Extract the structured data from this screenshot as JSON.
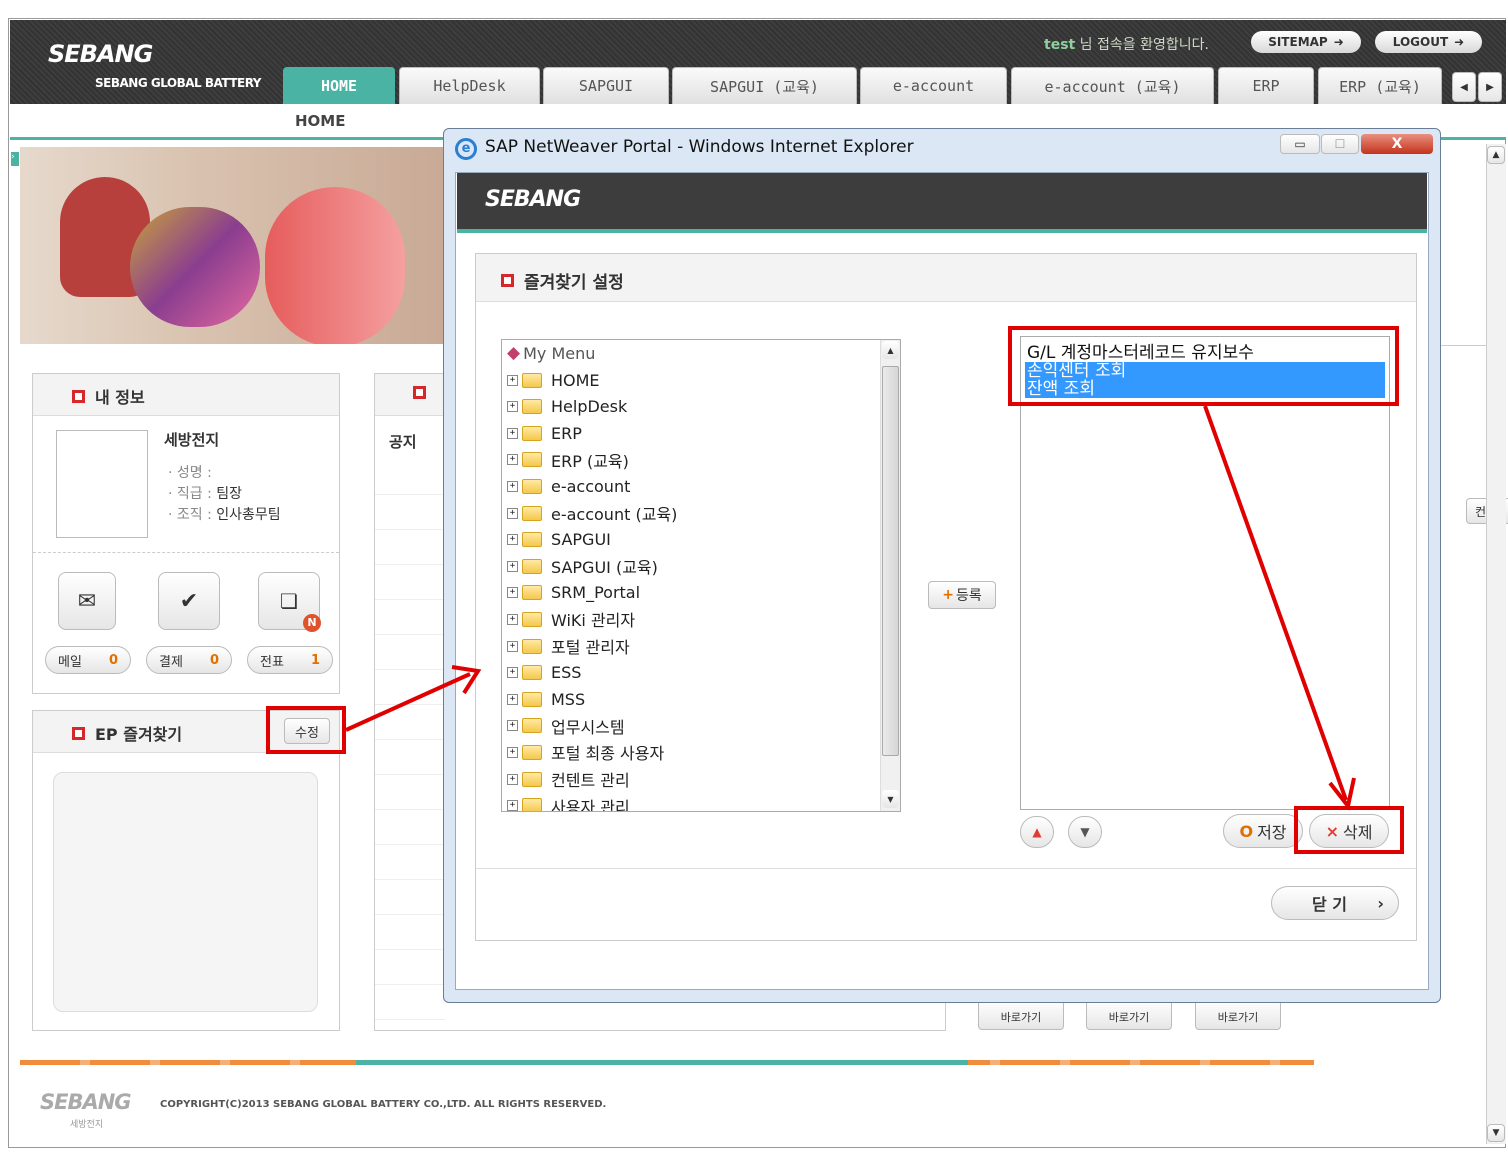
{
  "header": {
    "logo": "SEBANG",
    "logo_sub": "SEBANG GLOBAL BATTERY",
    "welcome_user": "test",
    "welcome_text": "님 접속을 환영합니다.",
    "sitemap": "SITEMAP",
    "logout": "LOGOUT",
    "tabs": [
      "HOME",
      "HelpDesk",
      "SAPGUI",
      "SAPGUI (교육)",
      "e-account",
      "e-account (교육)",
      "ERP",
      "ERP (교육)"
    ],
    "subnav": "HOME"
  },
  "myinfo": {
    "title": "내 정보",
    "company": "세방전지",
    "name_label": "· 성명 :",
    "rank_label": "· 직급 :",
    "rank_value": "팀장",
    "org_label": "· 조직 :",
    "org_value": "인사총무팀",
    "counters": [
      {
        "label": "메일",
        "value": "0"
      },
      {
        "label": "결제",
        "value": "0"
      },
      {
        "label": "전표",
        "value": "1"
      }
    ],
    "badge": "N"
  },
  "favorites": {
    "title": "EP 즐겨찾기",
    "edit_button": "수정"
  },
  "notice": {
    "label": "공지"
  },
  "shortcuts": [
    "바로가기",
    "바로가기",
    "바로가기"
  ],
  "side_tab": "컨텐",
  "footer": {
    "logo": "SEBANG",
    "logo_sub": "세방전지",
    "copyright": "COPYRIGHT(C)2013 SEBANG GLOBAL BATTERY CO.,LTD. ALL RIGHTS RESERVED."
  },
  "popup": {
    "window_title": "SAP NetWeaver Portal - Windows Internet Explorer",
    "logo": "SEBANG",
    "section_title": "즐겨찾기 설정",
    "tree_root": "My Menu",
    "tree_items": [
      "HOME",
      "HelpDesk",
      "ERP",
      "ERP (교육)",
      "e-account",
      "e-account (교육)",
      "SAPGUI",
      "SAPGUI (교육)",
      "SRM_Portal",
      "WiKi 관리자",
      "포털 관리자",
      "ESS",
      "MSS",
      "업무시스템",
      "포털 최종 사용자",
      "컨텐트 관리",
      "사용자 관리"
    ],
    "register_button": "등록",
    "list_items": [
      "G/L 계정마스터레코드 유지보수",
      "손익센터 조회",
      "잔액 조회"
    ],
    "save_button": "저장",
    "delete_button": "삭제",
    "close_button": "닫 기"
  },
  "colors": {
    "accent": "#4bb3a4",
    "highlight": "#e00000",
    "selection": "#3399ff"
  }
}
